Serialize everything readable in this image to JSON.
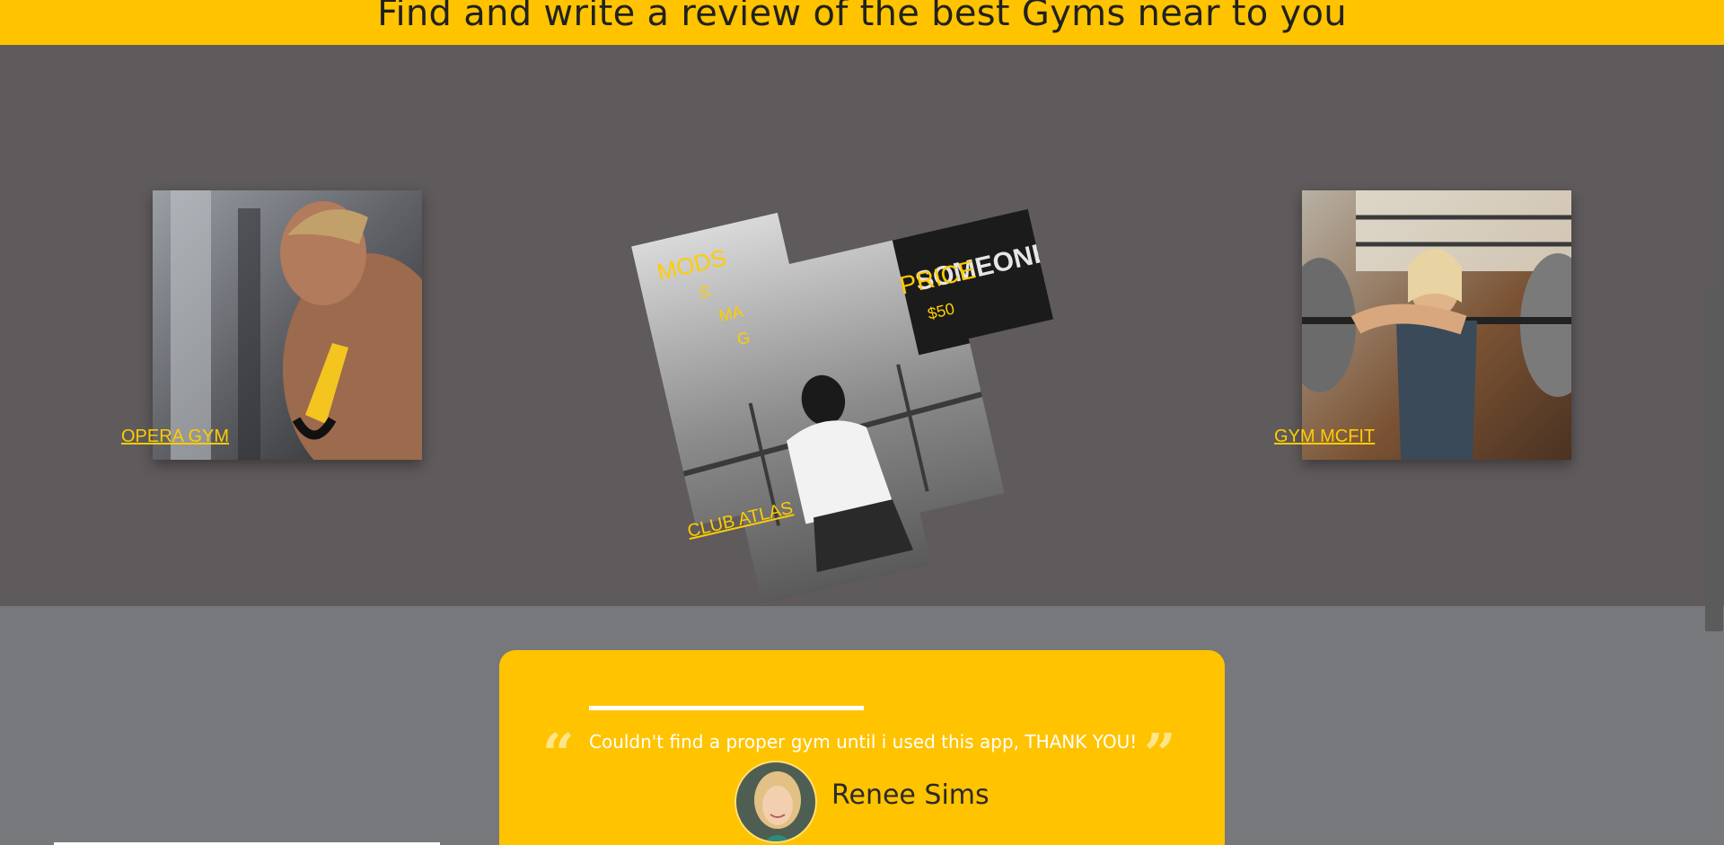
{
  "header": {
    "title": "Find and write a review of the best Gyms near to you"
  },
  "gyms": [
    {
      "name": "OPERA GYM"
    },
    {
      "name": "CLUB ATLAS",
      "mods_label": "MODS",
      "mods_items": [
        "S",
        "MA",
        "G"
      ],
      "price_label": "PRICE",
      "price_value": "$50"
    },
    {
      "name": "GYM MCFIT"
    }
  ],
  "testimonial": {
    "quote": "Couldn't find a proper gym until i used this app, THANK YOU!",
    "author": "Renee Sims"
  },
  "colors": {
    "accent": "#ffc300",
    "link": "#ffcc00",
    "section_bg": "#5f5a5b",
    "page_bg": "#77787b"
  }
}
